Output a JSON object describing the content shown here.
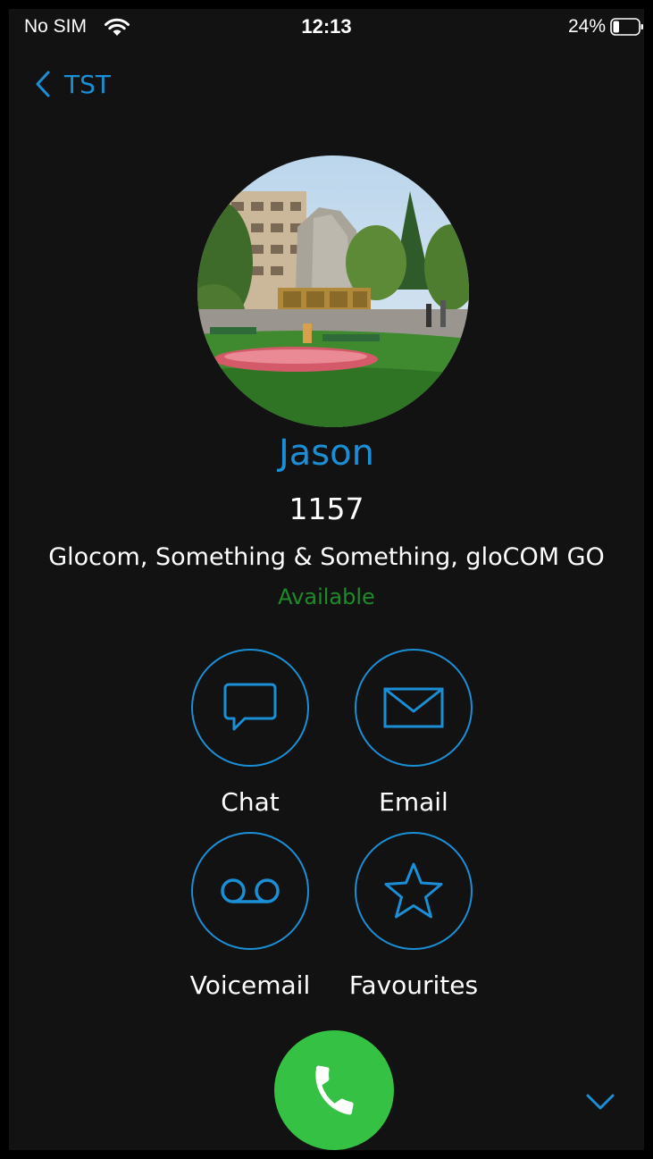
{
  "status_bar": {
    "carrier": "No SIM",
    "time": "12:13",
    "battery_percent": "24%",
    "battery_level": 0.24,
    "wifi_icon": "wifi-icon",
    "battery_icon": "battery-icon"
  },
  "nav": {
    "back_label": "TST",
    "back_icon": "chevron-left-icon"
  },
  "contact": {
    "name": "Jason",
    "extension": "1157",
    "groups": "Glocom, Something & Something, gloCOM GO",
    "presence": "Available"
  },
  "actions": {
    "chat": {
      "label": "Chat",
      "icon": "chat-bubble-icon"
    },
    "email": {
      "label": "Email",
      "icon": "envelope-icon"
    },
    "voicemail": {
      "label": "Voicemail",
      "icon": "voicemail-icon"
    },
    "favourites": {
      "label": "Favourites",
      "icon": "star-icon"
    }
  },
  "bottom": {
    "call_icon": "phone-icon",
    "expand_icon": "chevron-down-icon"
  },
  "colors": {
    "accent": "#1b8fd6",
    "background": "#121212",
    "presence_available": "#1e8a2a",
    "call_button": "#35c144"
  }
}
